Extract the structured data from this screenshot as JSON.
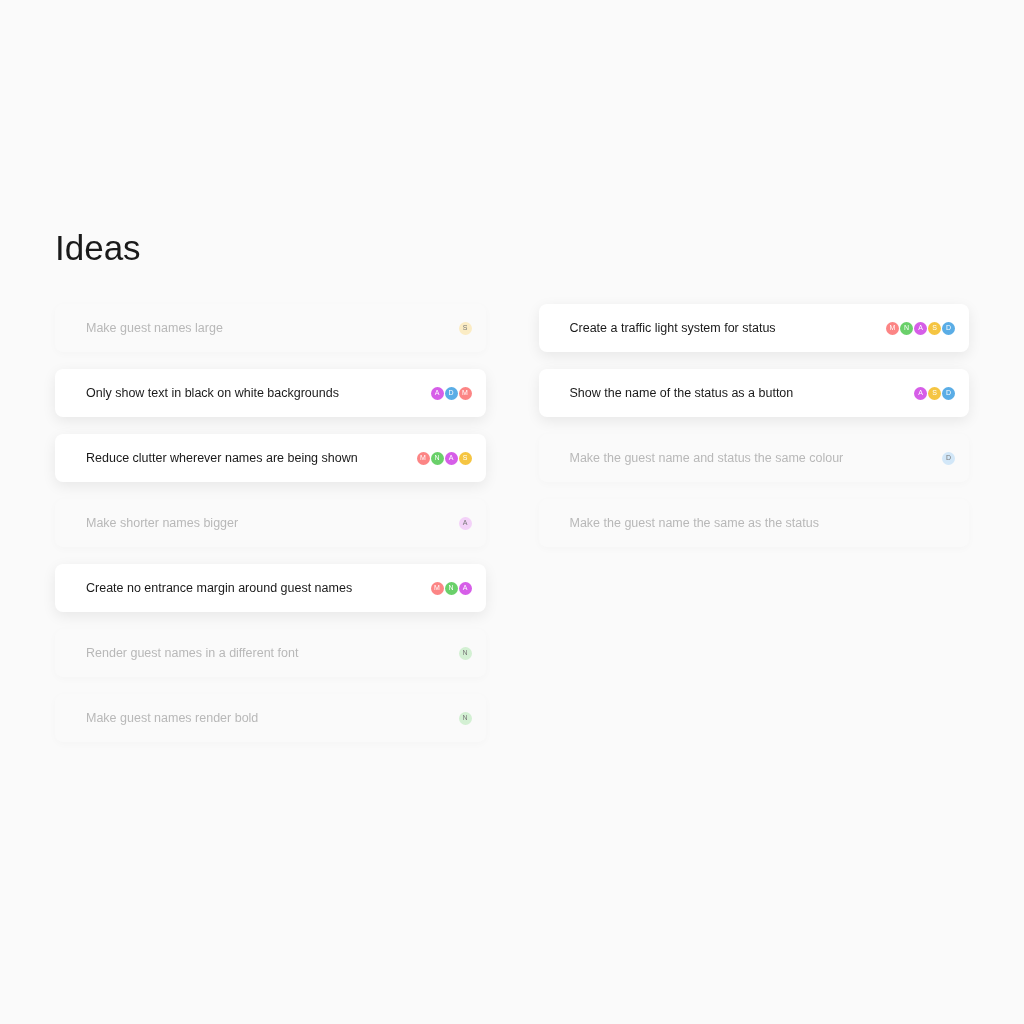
{
  "title": "Ideas",
  "columns": [
    {
      "cards": [
        {
          "text": "Make guest names large",
          "active": false,
          "avatars": [
            {
              "letter": "S",
              "color": "#fbecc4"
            }
          ]
        },
        {
          "text": "Only show text in black on white backgrounds",
          "active": true,
          "avatars": [
            {
              "letter": "A",
              "color": "#d65ee8"
            },
            {
              "letter": "D",
              "color": "#5aade6"
            },
            {
              "letter": "M",
              "color": "#fc8585"
            }
          ]
        },
        {
          "text": "Reduce clutter wherever names are being shown",
          "active": true,
          "avatars": [
            {
              "letter": "M",
              "color": "#fc8585"
            },
            {
              "letter": "N",
              "color": "#6ad06a"
            },
            {
              "letter": "A",
              "color": "#d65ee8"
            },
            {
              "letter": "S",
              "color": "#f5c542"
            }
          ]
        },
        {
          "text": "Make shorter names bigger",
          "active": false,
          "avatars": [
            {
              "letter": "A",
              "color": "#f3d2f8"
            }
          ]
        },
        {
          "text": "Create no entrance margin around guest names",
          "active": true,
          "avatars": [
            {
              "letter": "M",
              "color": "#fc8585"
            },
            {
              "letter": "N",
              "color": "#6ad06a"
            },
            {
              "letter": "A",
              "color": "#d65ee8"
            }
          ]
        },
        {
          "text": "Render guest names in a different font",
          "active": false,
          "avatars": [
            {
              "letter": "N",
              "color": "#d3f0d3"
            }
          ]
        },
        {
          "text": "Make guest names render bold",
          "active": false,
          "avatars": [
            {
              "letter": "N",
              "color": "#d3f0d3"
            }
          ]
        }
      ]
    },
    {
      "cards": [
        {
          "text": "Create a traffic light system for status",
          "active": true,
          "avatars": [
            {
              "letter": "M",
              "color": "#fc8585"
            },
            {
              "letter": "N",
              "color": "#6ad06a"
            },
            {
              "letter": "A",
              "color": "#d65ee8"
            },
            {
              "letter": "S",
              "color": "#f5c542"
            },
            {
              "letter": "D",
              "color": "#5aade6"
            }
          ]
        },
        {
          "text": "Show the name of the status as a button",
          "active": true,
          "avatars": [
            {
              "letter": "A",
              "color": "#d65ee8"
            },
            {
              "letter": "S",
              "color": "#f5c542"
            },
            {
              "letter": "D",
              "color": "#5aade6"
            }
          ]
        },
        {
          "text": "Make the guest name and status the same colour",
          "active": false,
          "avatars": [
            {
              "letter": "D",
              "color": "#d2e7f8"
            }
          ]
        },
        {
          "text": "Make the guest name the same as the status",
          "active": false
        }
      ]
    }
  ]
}
